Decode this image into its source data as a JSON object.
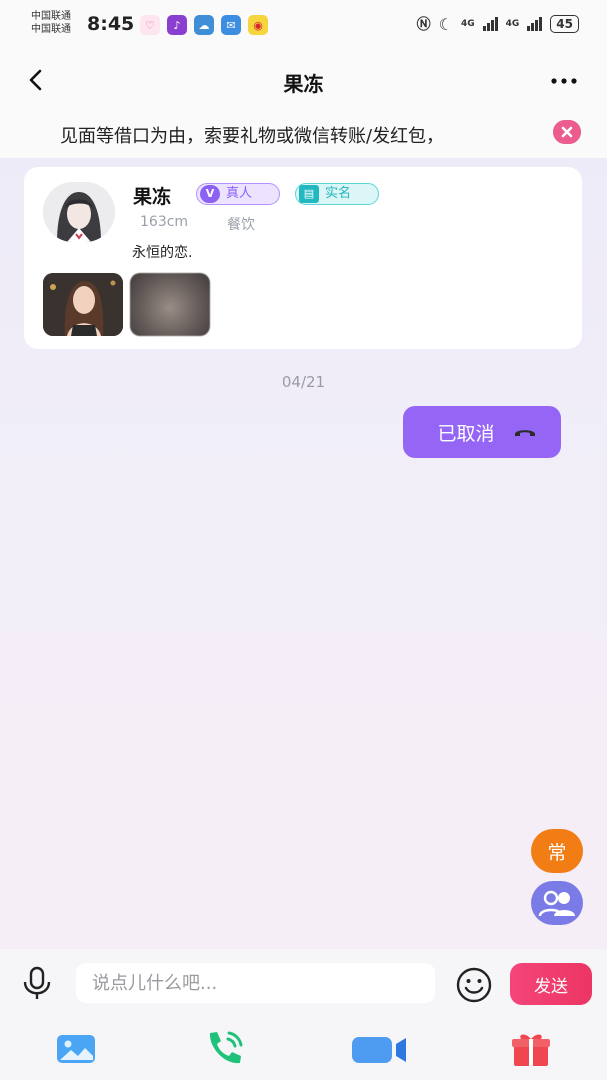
{
  "status_bar": {
    "carrier_1": "中国联通",
    "carrier_2": "中国联通",
    "time": "8:45",
    "network_1": "4G",
    "network_2": "4G",
    "battery": "45",
    "icons": [
      "nfc-icon",
      "moon-icon",
      "signal-icon",
      "battery-icon"
    ]
  },
  "header": {
    "title": "果冻",
    "back_icon": "chevron-left-icon",
    "more_icon": "more-dots-icon"
  },
  "notice": {
    "text": "见面等借口为由，索要礼物或微信转账/发红包，"
  },
  "profile": {
    "name": "果冻",
    "badge_real": "真人",
    "badge_real_icon": "V",
    "badge_auth": "实名",
    "height": "163cm",
    "job": "餐饮",
    "bio": "永恒的恋."
  },
  "chat": {
    "date": "04/21",
    "message": "已取消",
    "message_icon": "hangup-phone-icon"
  },
  "floating": {
    "common_label": "常"
  },
  "input": {
    "placeholder": "说点儿什么吧...",
    "send_label": "发送"
  },
  "toolbar": {
    "items": [
      "image-icon",
      "voice-call-icon",
      "video-call-icon",
      "gift-icon"
    ]
  },
  "colors": {
    "accent_purple": "#9566f6",
    "send_pink": "#f4457a",
    "common_orange": "#f27d15",
    "close_pink": "#ec5c8e"
  }
}
